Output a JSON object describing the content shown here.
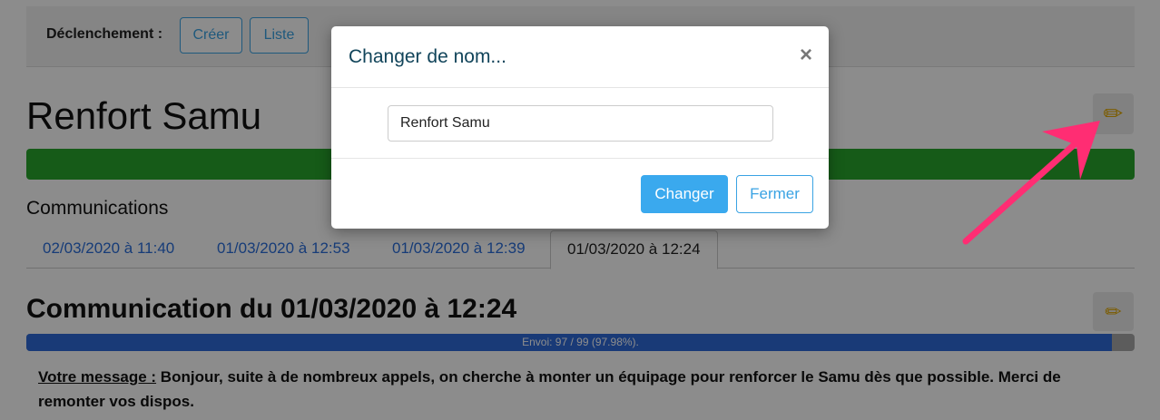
{
  "trigger": {
    "label": "Déclenchement :",
    "create_label": "Créer",
    "list_label": "Liste"
  },
  "page": {
    "title": "Renfort Samu",
    "edit_icon": "pencil-icon",
    "colors": {
      "status_bar": "#29a62d",
      "progress": "#2f6bd9",
      "accent": "#3aa3e3"
    }
  },
  "communications": {
    "heading": "Communications",
    "tabs": [
      {
        "label": "02/03/2020 à 11:40",
        "active": false
      },
      {
        "label": "01/03/2020 à 12:53",
        "active": false
      },
      {
        "label": "01/03/2020 à 12:39",
        "active": false
      },
      {
        "label": "01/03/2020 à 12:24",
        "active": true
      }
    ]
  },
  "communication": {
    "title": "Communication du 01/03/2020 à 12:24",
    "progress_text": "Envoi: 97 / 99 (97.98%).",
    "progress_fraction": 0.9798,
    "message_label": "Votre message :",
    "message_text": " Bonjour, suite à de nombreux appels, on cherche à monter un équipage pour renforcer le Samu dès que possible. Merci de remonter vos dispos."
  },
  "modal": {
    "title": "Changer de nom...",
    "close_glyph": "×",
    "input_value": "Renfort Samu",
    "submit_label": "Changer",
    "close_label": "Fermer"
  }
}
